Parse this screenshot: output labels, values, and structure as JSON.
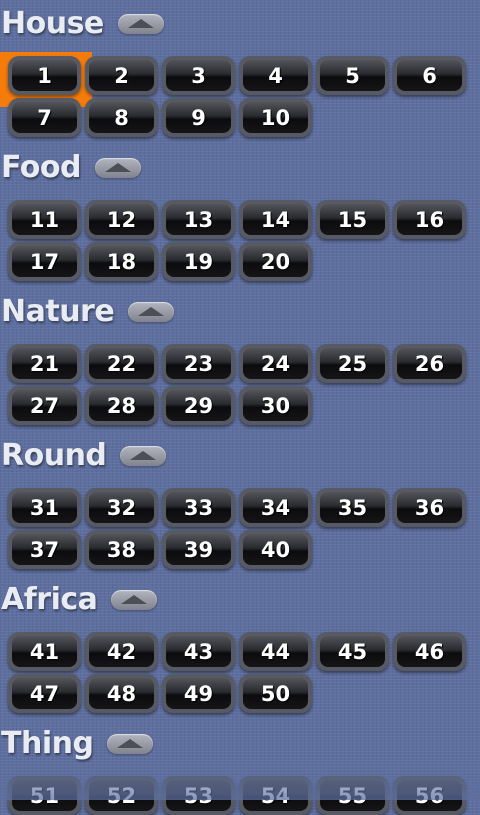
{
  "colors": {
    "background": "#5e6f9f",
    "selection": "#f47b0c",
    "button_text": "#ffffff",
    "title_text": "#e9ecf3"
  },
  "selected_level": "1",
  "sections": [
    {
      "title": "House",
      "levels": [
        "1",
        "2",
        "3",
        "4",
        "5",
        "6",
        "7",
        "8",
        "9",
        "10"
      ]
    },
    {
      "title": "Food",
      "levels": [
        "11",
        "12",
        "13",
        "14",
        "15",
        "16",
        "17",
        "18",
        "19",
        "20"
      ]
    },
    {
      "title": "Nature",
      "levels": [
        "21",
        "22",
        "23",
        "24",
        "25",
        "26",
        "27",
        "28",
        "29",
        "30"
      ]
    },
    {
      "title": "Round",
      "levels": [
        "31",
        "32",
        "33",
        "34",
        "35",
        "36",
        "37",
        "38",
        "39",
        "40"
      ]
    },
    {
      "title": "Africa",
      "levels": [
        "41",
        "42",
        "43",
        "44",
        "45",
        "46",
        "47",
        "48",
        "49",
        "50"
      ]
    },
    {
      "title": "Thing",
      "levels": [
        "51",
        "52",
        "53",
        "54",
        "55",
        "56"
      ]
    }
  ],
  "icons": {
    "collapse": "chevron-up-icon"
  }
}
